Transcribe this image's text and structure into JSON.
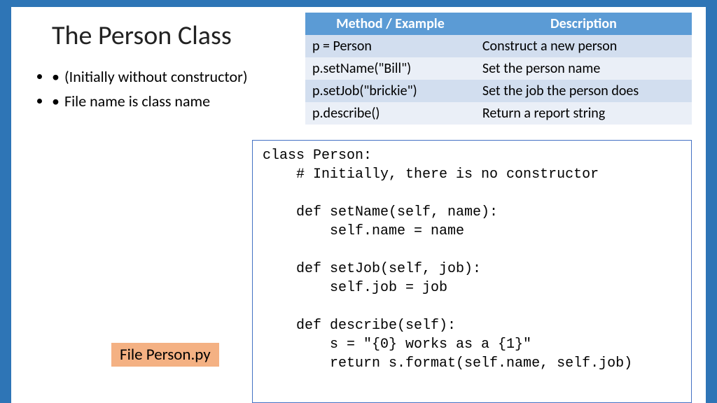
{
  "title": "The Person Class",
  "bullets": [
    "(Initially without constructor)",
    "File name is class name"
  ],
  "table": {
    "headers": [
      "Method / Example",
      "Description"
    ],
    "rows": [
      [
        "p = Person",
        "Construct a new person"
      ],
      [
        "p.setName(\"Bill\")",
        "Set the person name"
      ],
      [
        "p.setJob(\"brickie\")",
        "Set the job the person does"
      ],
      [
        "p.describe()",
        "Return a report string"
      ]
    ]
  },
  "code": "class Person:\n    # Initially, there is no constructor\n\n    def setName(self, name):\n        self.name = name\n\n    def setJob(self, job):\n        self.job = job\n\n    def describe(self):\n        s = \"{0} works as a {1}\"\n        return s.format(self.name, self.job)",
  "file_label": "File Person.py"
}
